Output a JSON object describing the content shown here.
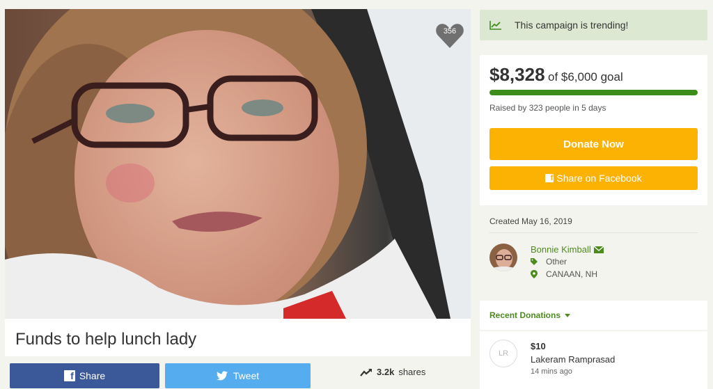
{
  "campaign": {
    "title": "Funds to help lunch lady",
    "heart_count": "356"
  },
  "share_row": {
    "facebook_label": "Share",
    "twitter_label": "Tweet",
    "shares_count": "3.2k",
    "shares_label": "shares"
  },
  "trending": {
    "text": "This campaign is trending!",
    "icon": "trend-chart-icon"
  },
  "stats": {
    "raised": "$8,328",
    "goal_text": "of $6,000 goal",
    "progress_fraction": 1.0,
    "raised_by": "Raised by 323 people in 5 days",
    "donate_label": "Donate Now",
    "share_fb_label": "Share on Facebook"
  },
  "created": "Created May 16, 2019",
  "organizer": {
    "name": "Bonnie Kimball",
    "category": "Other",
    "location": "CANAAN, NH"
  },
  "recent_donations": {
    "label": "Recent Donations",
    "items": [
      {
        "initials": "LR",
        "amount": "$10",
        "name": "Lakeram Ramprasad",
        "time": "14 mins ago"
      }
    ]
  },
  "colors": {
    "accent_green": "#4d8b1f",
    "progress_green": "#3c8c1a",
    "donate_orange": "#fbb203",
    "facebook_blue": "#3b5998",
    "twitter_blue": "#55acee",
    "trend_bg": "#dde8d2"
  }
}
